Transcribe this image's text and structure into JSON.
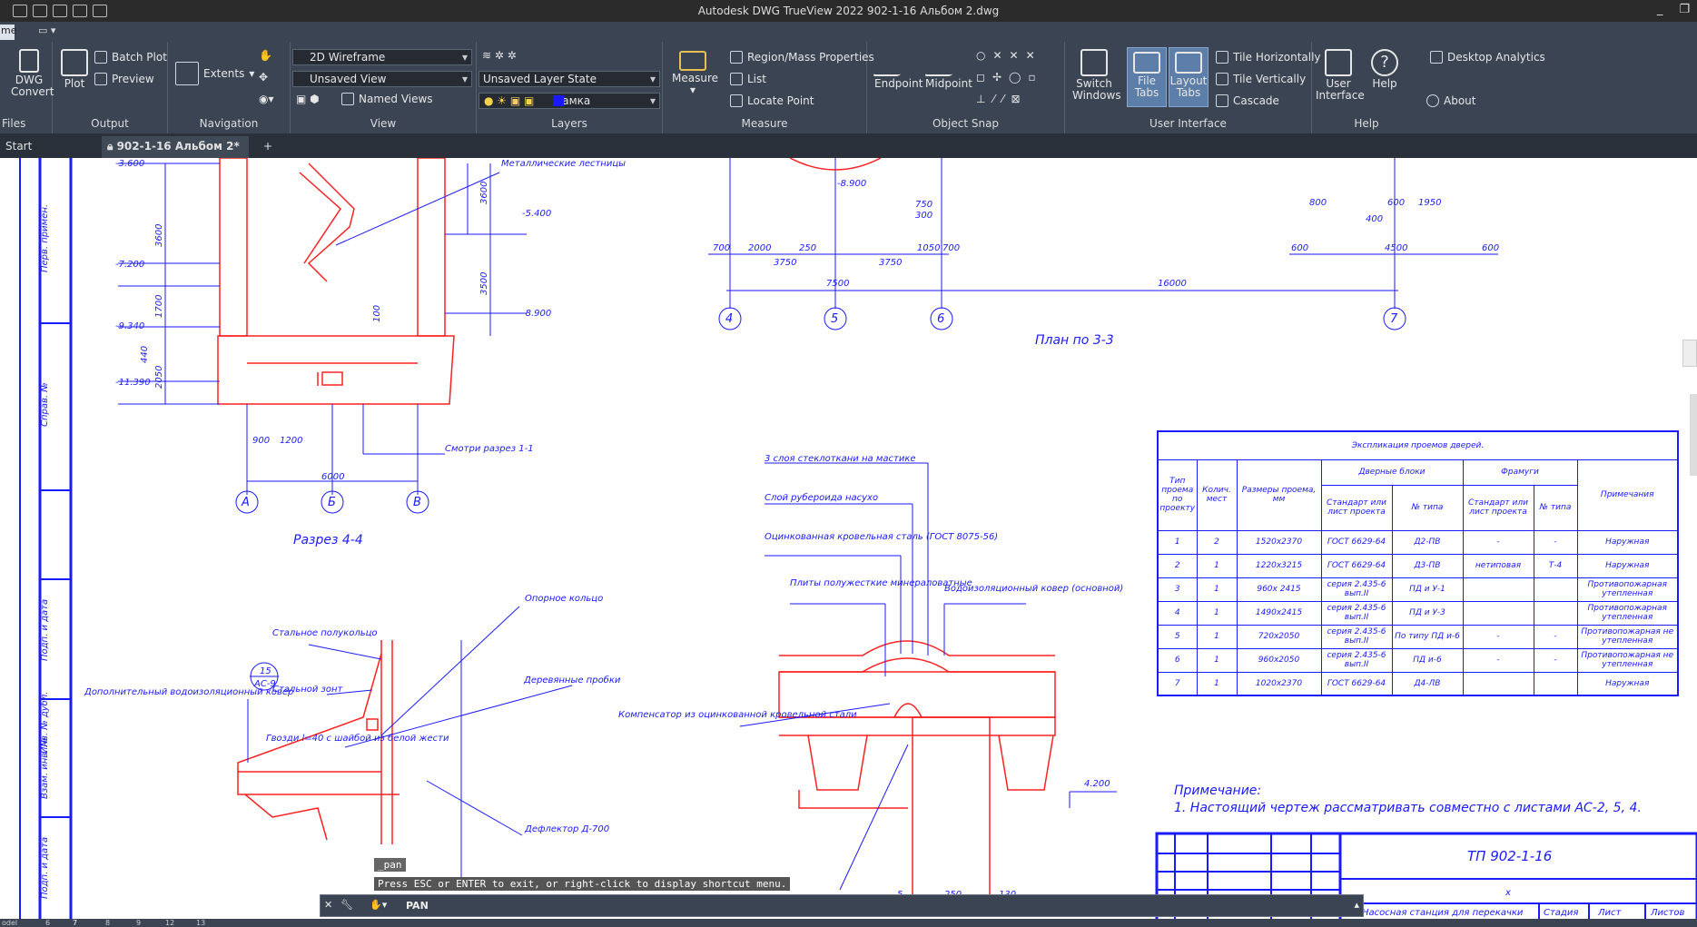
{
  "window": {
    "title": "Autodesk DWG TrueView 2022    902-1-16 Альбом 2.dwg",
    "home_tab": "me"
  },
  "ribbon": {
    "files": {
      "label": "Files",
      "dwg_convert": "DWG Convert"
    },
    "output": {
      "label": "Output",
      "plot": "Plot",
      "batch_plot": "Batch Plot",
      "preview": "Preview"
    },
    "navigation": {
      "label": "Navigation",
      "extents": "Extents"
    },
    "view": {
      "label": "View",
      "visual_style": "2D Wireframe",
      "saved_view": "Unsaved View",
      "named_views": "Named Views"
    },
    "layers": {
      "label": "Layers",
      "layer_state": "Unsaved Layer State",
      "current_layer": "Рамка"
    },
    "measure": {
      "label": "Measure",
      "measure": "Measure",
      "region_mass": "Region/Mass Properties",
      "list": "List",
      "locate_point": "Locate Point"
    },
    "object_snap": {
      "label": "Object Snap",
      "endpoint": "Endpoint",
      "midpoint": "Midpoint"
    },
    "user_interface": {
      "label": "User Interface",
      "switch_windows": "Switch Windows",
      "file_tabs": "File Tabs",
      "layout_tabs": "Layout Tabs",
      "tile_h": "Tile Horizontally",
      "tile_v": "Tile Vertically",
      "cascade": "Cascade",
      "user_interface_btn": "User Interface"
    },
    "help": {
      "label": "Help",
      "help": "Help",
      "desktop_analytics": "Desktop Analytics",
      "about": "About"
    }
  },
  "tabs": {
    "start": "Start",
    "active": "902-1-16 Альбом 2*"
  },
  "drawing": {
    "plan_title": "План по 3-3",
    "section_title": "Разрез 4-4",
    "axes_plan": [
      "4",
      "5",
      "6",
      "7"
    ],
    "axes_section": [
      "А",
      "Б",
      "В"
    ],
    "dims_plan": [
      "700",
      "2000",
      "250",
      "3750",
      "3750",
      "7500",
      "1050",
      "700",
      "16000",
      "750",
      "300",
      "800",
      "600",
      "1950",
      "400",
      "600",
      "4500",
      "600",
      "-8.900"
    ],
    "dims_section": [
      "-3.600",
      "-5.400",
      "-7.200",
      "-8.900",
      "-9.340",
      "-11.390",
      "3600",
      "3600",
      "3500",
      "1700",
      "440",
      "2050",
      "100",
      "900",
      "1200",
      "6000"
    ],
    "labels_section": [
      "Металлические лестницы",
      "Смотри разрез 1-1"
    ],
    "side_labels": [
      "Перв. примен.",
      "Справ. №",
      "Подп. и дата",
      "Инв. № дубл.",
      "Взам. инв. №",
      "Подп. и дата"
    ],
    "detail1": [
      "Опорное кольцо",
      "Стальное полукольцо",
      "Стальной зонт",
      "Дополнительный водоизоляционный ковер",
      "Деревянные пробки",
      "Гвозди l=40 с шайбой из белой жести",
      "Дефлектор Д-700",
      "15",
      "АС-9"
    ],
    "detail2": [
      "3 слоя стеклоткани на мастике",
      "Слой рубероида насухо",
      "Оцинкованная кровельная сталь (ГОСТ 8075-56)",
      "Плиты полужесткие минераловатные",
      "Водоизоляционный ковер (основной)",
      "Компенсатор из оцинкованной кровельной стали",
      "4.200",
      "5",
      "250",
      "130"
    ],
    "note_title": "Примечание:",
    "note_text": "1. Настоящий чертеж рассматривать совместно с листами АС-2, 5, 4.",
    "stamp_code": "ТП 902-1-16",
    "stamp_bottom": [
      "Насосная станция для перекачки",
      "Стадия",
      "Лист",
      "Листов"
    ],
    "stamp_x": "x"
  },
  "table": {
    "title": "Экспликация проемов дверей.",
    "headers": {
      "type": "Тип проема по проекту",
      "count": "Колич. мест",
      "size": "Размеры проема, мм",
      "door_blocks": "Дверные блоки",
      "frames": "Фрамуги",
      "note": "Примечания",
      "standard": "Стандарт или лист проекта",
      "type_no": "№ типа",
      "standard2": "Стандарт или лист проекта",
      "type_no2": "№ типа"
    },
    "rows": [
      [
        "1",
        "2",
        "1520х2370",
        "ГОСТ 6629-64",
        "Д2-ПВ",
        "-",
        "-",
        "Наружная"
      ],
      [
        "2",
        "1",
        "1220х3215",
        "ГОСТ 6629-64",
        "Д3-ПВ",
        "нетиповая",
        "Т-4",
        "Наружная"
      ],
      [
        "3",
        "1",
        "960х 2415",
        "серия 2.435-6 вып.II",
        "ПД и У-1",
        "",
        "",
        "Противопожарная утепленная"
      ],
      [
        "4",
        "1",
        "1490х2415",
        "серия 2.435-6 вып.II",
        "ПД и У-3",
        "",
        "",
        "Противопожарная утепленная"
      ],
      [
        "5",
        "1",
        "720х2050",
        "серия 2.435-6 вып.II",
        "По типу ПД и-6",
        "-",
        "-",
        "Противопожарная не утепленная"
      ],
      [
        "6",
        "1",
        "960х2050",
        "серия 2.435-6 вып.II",
        "ПД и-6",
        "-",
        "-",
        "Противопожарная не утепленная"
      ],
      [
        "7",
        "1",
        "1020х2370",
        "ГОСТ 6629-64",
        "Д4-ЛВ",
        "",
        "",
        "Наружная"
      ]
    ]
  },
  "command": {
    "history1": "_pan",
    "history2": "Press ESC or ENTER to exit, or right-click to display shortcut menu.",
    "input": "PAN"
  },
  "status": {
    "items": [
      "odel",
      "6",
      "7",
      "8",
      "9",
      "12",
      "13"
    ]
  },
  "colors": {
    "accent": "#1a1aff",
    "red": "#ff2020",
    "ribbon": "#3b4453"
  }
}
